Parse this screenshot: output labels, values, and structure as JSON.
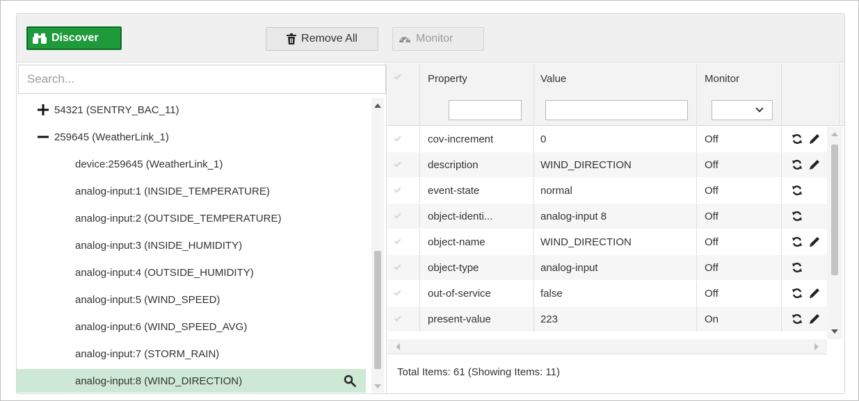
{
  "toolbar": {
    "discover_label": "Discover",
    "remove_all_label": "Remove All",
    "monitor_label": "Monitor"
  },
  "colors": {
    "discover": "#1e9a3b",
    "selected_row": "#cde9d5"
  },
  "tree": {
    "search_placeholder": "Search...",
    "items": [
      {
        "label": "54321 (SENTRY_BAC_11)",
        "toggle": "plus"
      },
      {
        "label": "259645 (WeatherLink_1)",
        "toggle": "minus"
      },
      {
        "label": "device:259645 (WeatherLink_1)"
      },
      {
        "label": "analog-input:1 (INSIDE_TEMPERATURE)"
      },
      {
        "label": "analog-input:2 (OUTSIDE_TEMPERATURE)"
      },
      {
        "label": "analog-input:3 (INSIDE_HUMIDITY)"
      },
      {
        "label": "analog-input:4 (OUTSIDE_HUMIDITY)"
      },
      {
        "label": "analog-input:5 (WIND_SPEED)"
      },
      {
        "label": "analog-input:6 (WIND_SPEED_AVG)"
      },
      {
        "label": "analog-input:7 (STORM_RAIN)"
      },
      {
        "label": "analog-input:8 (WIND_DIRECTION)",
        "selected": true
      }
    ]
  },
  "grid": {
    "headers": {
      "property": "Property",
      "value": "Value",
      "monitor": "Monitor"
    },
    "rows": [
      {
        "property": "cov-increment",
        "value": "0",
        "monitor": "Off",
        "editable": true
      },
      {
        "property": "description",
        "value": "WIND_DIRECTION",
        "monitor": "Off",
        "editable": true
      },
      {
        "property": "event-state",
        "value": "normal",
        "monitor": "Off",
        "editable": false
      },
      {
        "property": "object-identi...",
        "value": "analog-input 8",
        "monitor": "Off",
        "editable": false
      },
      {
        "property": "object-name",
        "value": "WIND_DIRECTION",
        "monitor": "Off",
        "editable": true
      },
      {
        "property": "object-type",
        "value": "analog-input",
        "monitor": "Off",
        "editable": false
      },
      {
        "property": "out-of-service",
        "value": "false",
        "monitor": "Off",
        "editable": true
      },
      {
        "property": "present-value",
        "value": "223",
        "monitor": "On",
        "editable": true
      }
    ],
    "footer": "Total Items: 61 (Showing Items: 11)"
  }
}
